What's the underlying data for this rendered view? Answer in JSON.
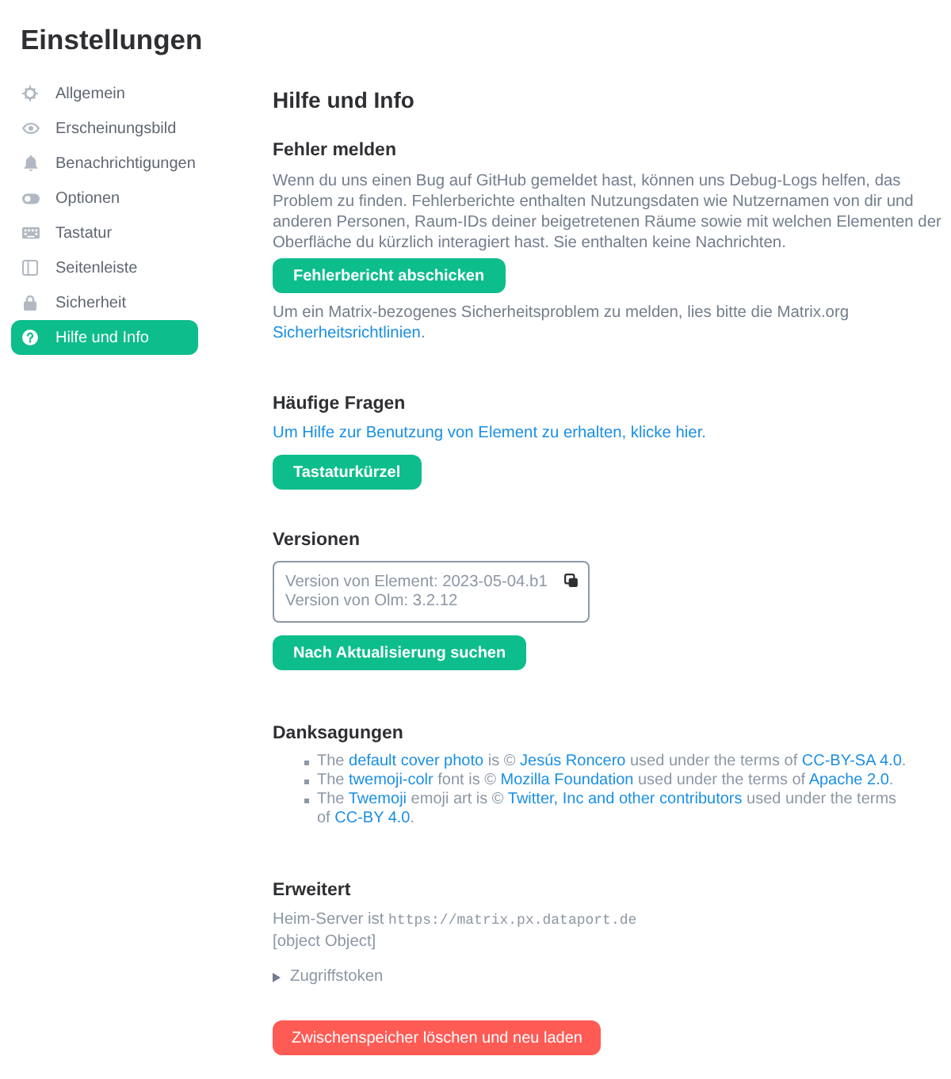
{
  "window": {
    "title": "Einstellungen"
  },
  "sidebar": {
    "items": [
      {
        "label": "Allgemein",
        "selected": false
      },
      {
        "label": "Erscheinungsbild",
        "selected": false
      },
      {
        "label": "Benachrichtigungen",
        "selected": false
      },
      {
        "label": "Optionen",
        "selected": false
      },
      {
        "label": "Tastatur",
        "selected": false
      },
      {
        "label": "Seitenleiste",
        "selected": false
      },
      {
        "label": "Sicherheit",
        "selected": false
      },
      {
        "label": "Hilfe und Info",
        "selected": true
      }
    ]
  },
  "page": {
    "heading": "Hilfe und Info"
  },
  "bug_report": {
    "heading": "Fehler melden",
    "description": "Wenn du uns einen Bug auf GitHub gemeldet hast, können uns Debug-Logs helfen, das Problem zu finden. Fehlerberichte enthalten Nutzungsdaten wie Nutzernamen von dir und anderen Personen, Raum-IDs deiner beigetretenen Räume sowie mit welchen Elementen der Oberfläche du kürzlich interagiert hast. Sie enthalten keine Nachrichten.",
    "button": "Fehlerbericht abschicken",
    "security_note": [
      {
        "kind": "text",
        "text": "Um ein Matrix-bezogenes Sicherheitsproblem zu melden, lies bitte die Matrix.org "
      },
      {
        "kind": "link",
        "text": "Sicherheitsrichtlinien"
      },
      {
        "kind": "text",
        "text": "."
      }
    ]
  },
  "faq": {
    "heading": "Häufige Fragen",
    "link": "Um Hilfe zur Benutzung von Element zu erhalten, klicke hier.",
    "button": "Tastaturkürzel"
  },
  "versions": {
    "heading": "Versionen",
    "lines": [
      "Version von Element: 2023-05-04.b1",
      "Version von Olm: 3.2.12"
    ],
    "button": "Nach Aktualisierung suchen"
  },
  "credits": {
    "heading": "Danksagungen",
    "items": [
      [
        {
          "kind": "text",
          "text": "The "
        },
        {
          "kind": "link",
          "text": "default cover photo"
        },
        {
          "kind": "text",
          "text": " is © "
        },
        {
          "kind": "link",
          "text": "Jesús Roncero"
        },
        {
          "kind": "text",
          "text": " used under the terms of "
        },
        {
          "kind": "link",
          "text": "CC-BY-SA 4.0"
        },
        {
          "kind": "text",
          "text": "."
        }
      ],
      [
        {
          "kind": "text",
          "text": "The "
        },
        {
          "kind": "link",
          "text": "twemoji-colr"
        },
        {
          "kind": "text",
          "text": " font is © "
        },
        {
          "kind": "link",
          "text": "Mozilla Foundation"
        },
        {
          "kind": "text",
          "text": " used under the terms of "
        },
        {
          "kind": "link",
          "text": "Apache 2.0"
        },
        {
          "kind": "text",
          "text": "."
        }
      ],
      [
        {
          "kind": "text",
          "text": "The "
        },
        {
          "kind": "link",
          "text": "Twemoji"
        },
        {
          "kind": "text",
          "text": " emoji art is © "
        },
        {
          "kind": "link",
          "text": "Twitter, Inc and other contributors"
        },
        {
          "kind": "text",
          "text": " used under the terms of "
        },
        {
          "kind": "link",
          "text": "CC-BY 4.0"
        },
        {
          "kind": "text",
          "text": "."
        }
      ]
    ]
  },
  "advanced": {
    "heading": "Erweitert",
    "homeserver": [
      {
        "kind": "text",
        "text": "Heim-Server ist "
      },
      {
        "kind": "code",
        "text": "https://matrix.px.dataport.de"
      }
    ],
    "object_line": "[object Object]",
    "access_token": {
      "label": "Zugriffstoken",
      "expanded": false
    },
    "button": "Zwischenspeicher löschen und neu laden"
  }
}
